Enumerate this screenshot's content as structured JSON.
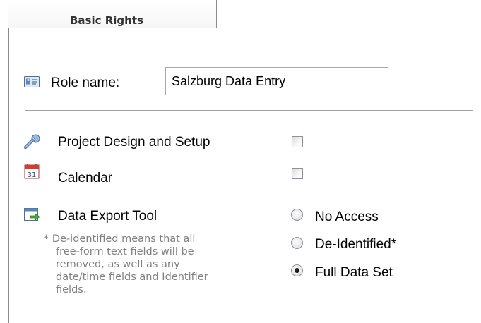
{
  "tab": {
    "label": "Basic Rights"
  },
  "role": {
    "label": "Role name:",
    "value": "Salzburg Data Entry"
  },
  "rights": [
    {
      "label": "Project Design and Setup",
      "icon": "wrench-icon",
      "checked": false
    },
    {
      "label": "Calendar",
      "icon": "calendar-icon",
      "calendar_day": "31",
      "checked": false
    }
  ],
  "export": {
    "label": "Data Export Tool",
    "icon": "export-icon",
    "options": [
      {
        "label": "No Access",
        "checked": false
      },
      {
        "label": "De-Identified*",
        "checked": false
      },
      {
        "label": "Full Data Set",
        "checked": true
      }
    ],
    "note_lines": [
      "* De-identified means that all",
      "free-form text fields will be",
      "removed, as well as any",
      "date/time fields and Identifier",
      "fields."
    ]
  }
}
